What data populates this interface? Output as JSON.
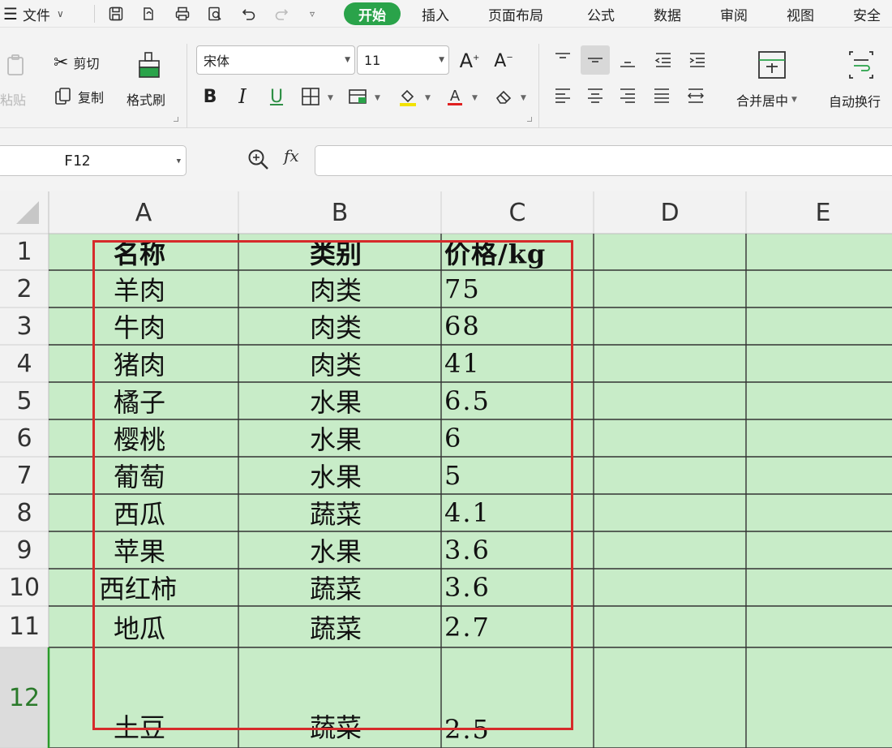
{
  "menubar": {
    "file_label": "文件",
    "tabs": [
      "开始",
      "插入",
      "页面布局",
      "公式",
      "数据",
      "审阅",
      "视图",
      "安全"
    ],
    "active_tab": "开始",
    "accent_color": "#2aa34a"
  },
  "ribbon": {
    "paste_label": "粘贴",
    "cut_label": "剪切",
    "copy_label": "复制",
    "format_painter_label": "格式刷",
    "font_name": "宋体",
    "font_size": "11",
    "merge_label": "合并居中",
    "wrap_label": "自动换行"
  },
  "formula_bar": {
    "name_box": "F12",
    "fx_label": "fx",
    "formula_value": ""
  },
  "sheet": {
    "columns": [
      "A",
      "B",
      "C",
      "D",
      "E"
    ],
    "rows": [
      "1",
      "2",
      "3",
      "4",
      "5",
      "6",
      "7",
      "8",
      "9",
      "10",
      "11",
      "12"
    ],
    "selected_row": "12",
    "cells": [
      [
        "名称",
        "类别",
        "价格/kg"
      ],
      [
        "羊肉",
        "肉类",
        "75"
      ],
      [
        "牛肉",
        "肉类",
        "68"
      ],
      [
        "猪肉",
        "肉类",
        "41"
      ],
      [
        "橘子",
        "水果",
        "6.5"
      ],
      [
        "樱桃",
        "水果",
        "6"
      ],
      [
        "葡萄",
        "水果",
        "5"
      ],
      [
        "西瓜",
        "蔬菜",
        "4.1"
      ],
      [
        "苹果",
        "水果",
        "3.6"
      ],
      [
        "西红柿",
        "蔬菜",
        "3.6"
      ],
      [
        "地瓜",
        "蔬菜",
        "2.7"
      ],
      [
        "土豆",
        "蔬菜",
        "2.5"
      ]
    ],
    "cell_fill_color": "#c8ecc8",
    "highlight_border_color": "#d62b2b"
  }
}
